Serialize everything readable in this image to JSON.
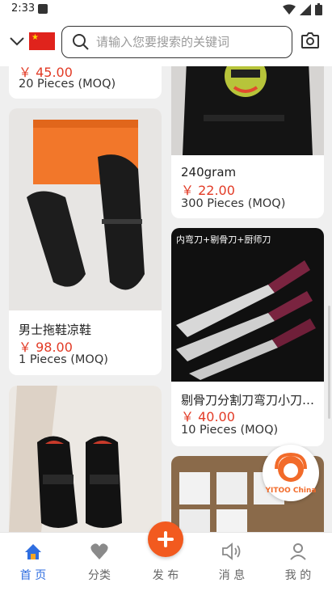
{
  "status_bar": {
    "time": "2:33"
  },
  "header": {
    "search_placeholder": "请输入您要搜索的关键词"
  },
  "products": [
    {
      "title": "",
      "price": "￥ 45.00",
      "moq": "20 Pieces (MOQ)"
    },
    {
      "title": "240gram",
      "price": "￥ 22.00",
      "moq": "300 Pieces (MOQ)"
    },
    {
      "title": "男士拖鞋凉鞋",
      "price": "￥ 98.00",
      "moq": "1 Pieces (MOQ)"
    },
    {
      "title": "剔骨刀分割刀弯刀小刀厨房刀具",
      "price": "￥ 40.00",
      "moq": "10 Pieces (MOQ)"
    }
  ],
  "knife_ad_title": "内弯刀+剔骨刀+厨师刀",
  "floating_brand": "YITOO China",
  "tabs": [
    {
      "label": "首 页",
      "icon": "home-icon"
    },
    {
      "label": "分类",
      "icon": "heart-icon"
    },
    {
      "label": "发 布",
      "icon": "plus-icon"
    },
    {
      "label": "消 息",
      "icon": "speaker-icon"
    },
    {
      "label": "我 的",
      "icon": "person-icon"
    }
  ],
  "colors": {
    "price": "#e23b26",
    "active_tab": "#2f6ee0",
    "publish": "#f25a1f"
  }
}
